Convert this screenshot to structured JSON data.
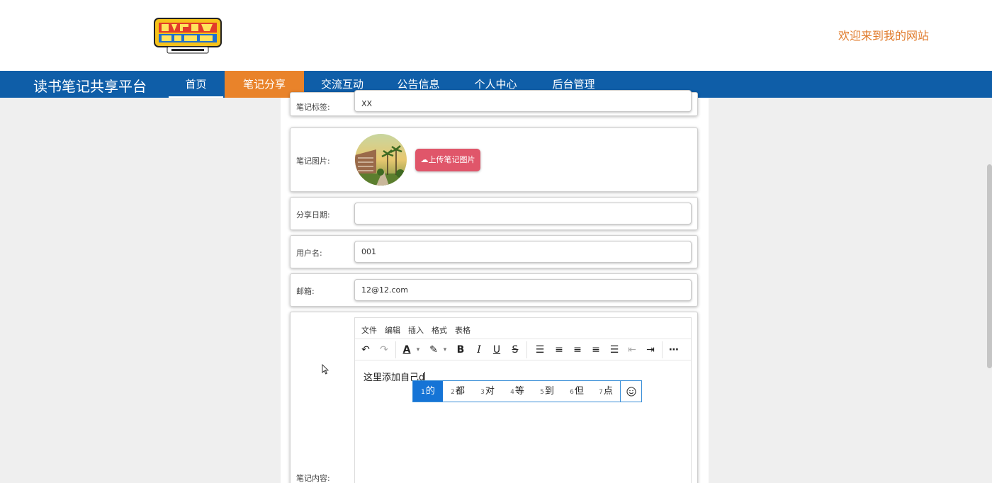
{
  "header": {
    "welcome": "欢迎来到我的网站",
    "logo_name": "digimon-logo"
  },
  "nav": {
    "brand": "读书笔记共享平台",
    "items": [
      {
        "label": "首页",
        "active": false
      },
      {
        "label": "笔记分享",
        "active": true
      },
      {
        "label": "交流互动",
        "active": false
      },
      {
        "label": "公告信息",
        "active": false
      },
      {
        "label": "个人中心",
        "active": false
      },
      {
        "label": "后台管理",
        "active": false
      }
    ],
    "colors": {
      "bar": "#0f5ea8",
      "active": "#e9832a"
    }
  },
  "form": {
    "tag": {
      "label": "笔记标签:",
      "value": "XX"
    },
    "image": {
      "label": "笔记图片:",
      "upload_label": "上传笔记图片"
    },
    "date": {
      "label": "分享日期:",
      "value": ""
    },
    "username": {
      "label": "用户名:",
      "value": "001"
    },
    "email": {
      "label": "邮箱:",
      "value": "12@12.com"
    },
    "content": {
      "label": "笔记内容:"
    }
  },
  "editor": {
    "menu": [
      "文件",
      "编辑",
      "插入",
      "格式",
      "表格"
    ],
    "text": "这里添加自己d",
    "toolbar_icons": [
      "undo-icon",
      "redo-icon",
      "font-color-icon",
      "highlight-icon",
      "bold-icon",
      "italic-icon",
      "underline-icon",
      "strikethrough-icon",
      "line-height-icon",
      "align-left-icon",
      "align-center-icon",
      "align-right-icon",
      "justify-icon",
      "outdent-icon",
      "indent-icon",
      "more-icon"
    ]
  },
  "ime": {
    "candidates": [
      {
        "num": "1",
        "text": "的"
      },
      {
        "num": "2",
        "text": "都"
      },
      {
        "num": "3",
        "text": "对"
      },
      {
        "num": "4",
        "text": "等"
      },
      {
        "num": "5",
        "text": "到"
      },
      {
        "num": "6",
        "text": "但"
      },
      {
        "num": "7",
        "text": "点"
      }
    ],
    "selected_color": "#1574d6"
  }
}
